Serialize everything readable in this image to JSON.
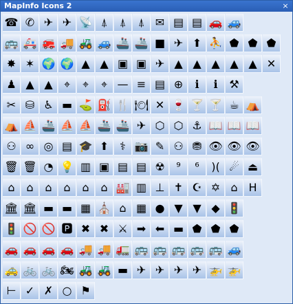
{
  "window": {
    "title": "MapInfo Icons 2",
    "close_label": "×"
  },
  "palette": {
    "rows": [
      [
        "☎",
        "✆",
        "✈",
        "✈",
        "📡",
        "⍋",
        "⍋",
        "⍋",
        "✉",
        "▤",
        "▤",
        "🚗",
        "🚙"
      ],
      [
        "🚌",
        "🚑",
        "🚒",
        "🚚",
        "🚜",
        "🚙",
        "🚢",
        "🚢",
        "■",
        "✈",
        "⬆",
        "⛹",
        "⬟",
        "⬟",
        "⬟"
      ],
      [
        "✸",
        "✶",
        "🌍",
        "🌍",
        "▲",
        "▲",
        "▣",
        "▣",
        "✈",
        "▲",
        "▲",
        "▲",
        "▲",
        "▲",
        "✕"
      ],
      [
        "♟",
        "▲",
        "▲",
        "⌖",
        "⌖",
        "⌖",
        "—",
        "≡",
        "▤",
        "⊕",
        "ℹ",
        "ℹ",
        "⚒"
      ],
      [
        "✂",
        "⛁",
        "♿",
        "▬",
        "⛳",
        "⛽",
        "🍴",
        "🍽",
        "✕",
        "🍷",
        "🍸",
        "🍸",
        "☕",
        "⛺"
      ],
      [
        "⛺",
        "⛵",
        "🚢",
        "⛵",
        "⛵",
        "🚢",
        "🚢",
        "✈",
        "⬡",
        "⬡",
        "⚓",
        "📖",
        "📖",
        "📖"
      ],
      [
        "⚇",
        "∞",
        "◎",
        "▤",
        "🎓",
        "⬆",
        "⚕",
        "📷",
        "✎",
        "⚇",
        "⛃",
        "👁",
        "👁",
        "👁"
      ],
      [
        "🗑",
        "🗑",
        "◔",
        "💡",
        "▥",
        "▣",
        "▤",
        "▤",
        "☢",
        "⁹",
        "⁶",
        ")(",
        "☄",
        "⏏"
      ],
      [
        "⌂",
        "⌂",
        "⌂",
        "⌂",
        "⌂",
        "⌂",
        "🏭",
        "▥",
        "⊥",
        "✝",
        "☪",
        "✡",
        "⌂",
        "H"
      ],
      [
        "🏛",
        "🏛",
        "▬",
        "▬",
        "▦",
        "⛪",
        "⌂",
        "▦",
        "●",
        "▼",
        "▼",
        "◆",
        "🚦"
      ],
      [
        "🚦",
        "🚫",
        "🚫",
        "🅿",
        "✖",
        "✖",
        "⚔",
        "➡",
        "⬅",
        "▬",
        "⬟",
        "⬟",
        "⬟"
      ],
      [
        "🚗",
        "🚗",
        "🚗",
        "🚗",
        "🚚",
        "🚚",
        "🚛",
        "🚌",
        "🚌",
        "🚌",
        "🚌",
        "🚌",
        "🚙"
      ],
      [
        "🚕",
        "🚲",
        "🚲",
        "🏍",
        "🚜",
        "🚜",
        "▬",
        "✈",
        "✈",
        "✈",
        "✈",
        "🚁",
        "🚁"
      ],
      [
        "⊢",
        "✓",
        "✗",
        "○",
        "⚑"
      ]
    ]
  }
}
